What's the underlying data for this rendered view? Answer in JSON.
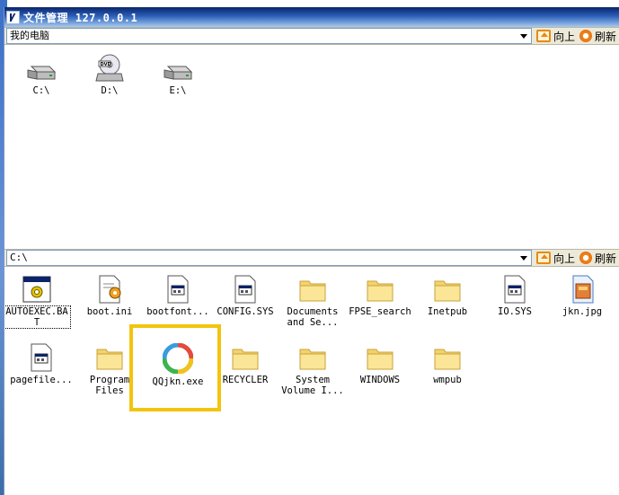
{
  "window": {
    "title": "文件管理  127.0.0.1"
  },
  "top_pane": {
    "path": "我的电脑",
    "up_label": "向上",
    "refresh_label": "刷新",
    "drives": [
      {
        "label": "C:\\",
        "icon": "hard-drive-icon"
      },
      {
        "label": "D:\\",
        "icon": "dvd-drive-icon"
      },
      {
        "label": "E:\\",
        "icon": "hard-drive-icon"
      }
    ]
  },
  "bottom_pane": {
    "path": "C:\\",
    "up_label": "向上",
    "refresh_label": "刷新",
    "files": [
      {
        "label": "AUTOEXEC.BA\nT",
        "icon": "batch-file-icon"
      },
      {
        "label": "boot.ini",
        "icon": "config-file-icon"
      },
      {
        "label": "bootfont...",
        "icon": "system-file-icon"
      },
      {
        "label": "CONFIG.SYS",
        "icon": "system-file-icon"
      },
      {
        "label": "Documents\nand Se...",
        "icon": "folder-icon"
      },
      {
        "label": "FPSE_search",
        "icon": "folder-icon"
      },
      {
        "label": "Inetpub",
        "icon": "folder-icon"
      },
      {
        "label": "IO.SYS",
        "icon": "system-file-icon"
      },
      {
        "label": "jkn.jpg",
        "icon": "image-file-icon"
      },
      {
        "label": "pagefile...",
        "icon": "system-file-icon"
      },
      {
        "label": "Program\nFiles",
        "icon": "folder-icon"
      },
      {
        "label": "QQjkn.exe",
        "icon": "qq-app-icon"
      },
      {
        "label": "RECYCLER",
        "icon": "folder-icon"
      },
      {
        "label": "System\nVolume I...",
        "icon": "folder-icon"
      },
      {
        "label": "WINDOWS",
        "icon": "folder-icon"
      },
      {
        "label": "wmpub",
        "icon": "folder-icon"
      }
    ]
  },
  "colors": {
    "highlight": "#f2c40d",
    "titlebar": "#0a246a",
    "toolbar_icon": "#e58a12"
  }
}
